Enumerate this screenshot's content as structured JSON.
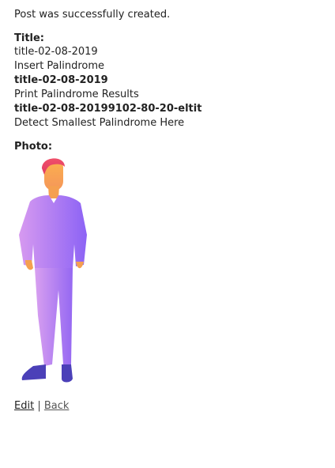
{
  "notice": "Post was successfully created.",
  "title_label": "Title:",
  "title_lines": [
    {
      "text": "title-02-08-2019",
      "bold": false
    },
    {
      "text": "Insert Palindrome",
      "bold": false
    },
    {
      "text": "title-02-08-2019",
      "bold": true
    },
    {
      "text": "Print Palindrome Results",
      "bold": false
    },
    {
      "text": "title-02-08-20199102-80-20-eltit",
      "bold": true
    },
    {
      "text": "Detect Smallest Palindrome Here",
      "bold": false
    }
  ],
  "photo_label": "Photo:",
  "photo": {
    "icon": "standing-person-illustration"
  },
  "nav": {
    "edit_label": "Edit",
    "separator": "|",
    "back_label": "Back"
  }
}
